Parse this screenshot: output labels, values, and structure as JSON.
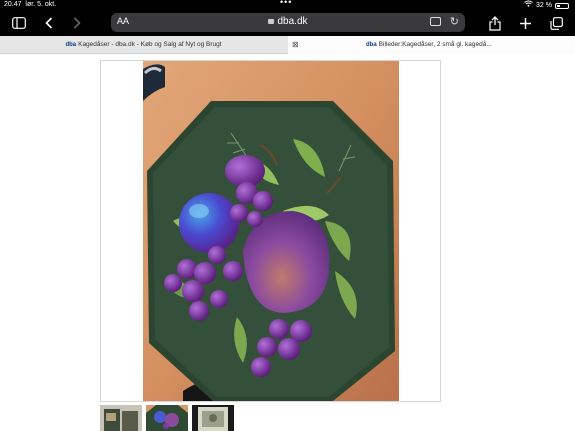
{
  "status": {
    "time": "20.47",
    "date": "lør. 5. okt.",
    "battery": "32 %",
    "battery_level": 0.32
  },
  "toolbar": {
    "aa_label": "AA",
    "url": "dba.dk",
    "icons": [
      "sidebar-icon",
      "back-icon",
      "forward-icon",
      "lock-icon",
      "reader-icon",
      "reload-icon",
      "share-icon",
      "add-tab-icon",
      "tabs-icon"
    ]
  },
  "tabs": [
    {
      "favicon": "dba",
      "title": "Kagedåser - dba.dk - Køb og Salg af Nyt og Brugt",
      "active": false
    },
    {
      "favicon": "dba",
      "title": "Billeder:Kagedåser, 2 små gl. kagedå...",
      "active": true
    }
  ],
  "colors": {
    "tin_green": "#2f4a32",
    "plum_purple": "#7a3aa0",
    "table_wood": "#d89a6a",
    "chrome_black": "#000000"
  }
}
